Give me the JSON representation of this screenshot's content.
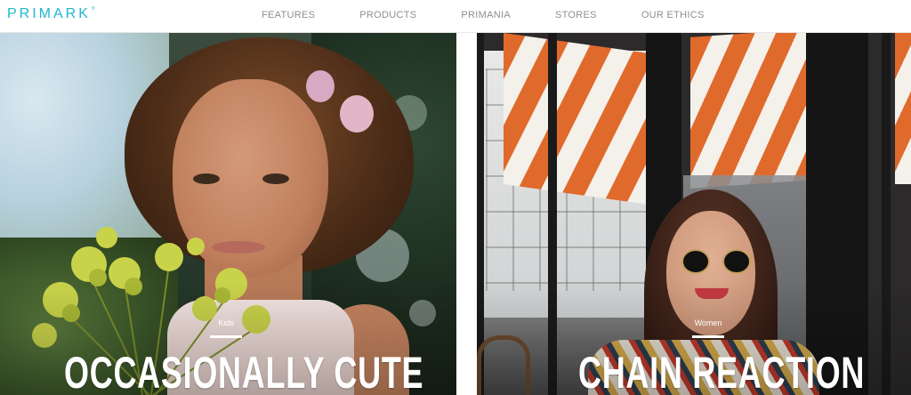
{
  "brand": {
    "logo_text": "PRIMARK",
    "registered_mark": "®",
    "logo_color": "#1fb7cf"
  },
  "nav": {
    "items": [
      {
        "label": "FEATURES"
      },
      {
        "label": "PRODUCTS"
      },
      {
        "label": "PRIMANIA"
      },
      {
        "label": "STORES"
      },
      {
        "label": "OUR ETHICS"
      }
    ]
  },
  "heroes": [
    {
      "category": "Kids",
      "headline": "OCCASIONALLY CUTE",
      "image_subject": "child-with-flowers-photo"
    },
    {
      "category": "Women",
      "headline": "CHAIN REACTION",
      "image_subject": "woman-in-sunglasses-photo"
    }
  ]
}
